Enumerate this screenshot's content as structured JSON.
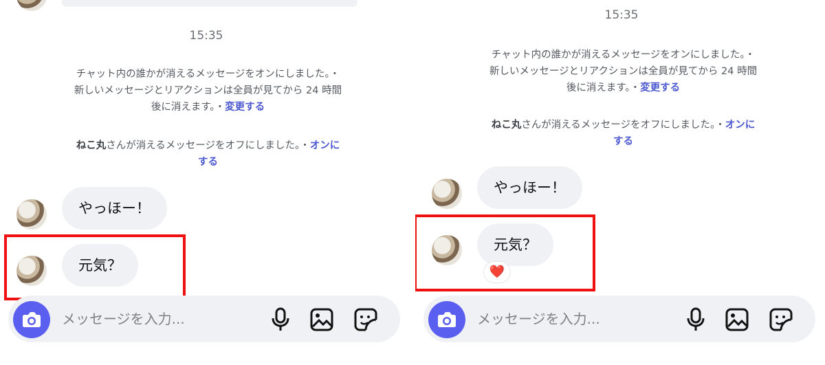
{
  "left": {
    "time": "15:35",
    "system_message_1": {
      "line1": "チャット内の誰かが消えるメッセージをオンにしました。・",
      "line2": "新しいメッセージとリアクションは全員が見てから 24 時間",
      "line3": "後に消えます。・",
      "link": "変更する"
    },
    "system_message_2": {
      "name": "ねこ丸",
      "text": "さんが消えるメッセージをオフにしました。・",
      "link1": "オンに",
      "link2": "する"
    },
    "messages": [
      {
        "text": "やっほー！"
      },
      {
        "text": "元気？"
      }
    ]
  },
  "right": {
    "time": "15:35",
    "system_message_1": {
      "line1": "チャット内の誰かが消えるメッセージをオンにしました。・",
      "line2": "新しいメッセージとリアクションは全員が見てから 24 時間",
      "line3": "後に消えます。・",
      "link": "変更する"
    },
    "system_message_2": {
      "name": "ねこ丸",
      "text": "さんが消えるメッセージをオフにしました。・",
      "link1": "オンに",
      "link2": "する"
    },
    "messages": [
      {
        "text": "やっほー！"
      },
      {
        "text": "元気？",
        "reaction": "❤️"
      }
    ]
  },
  "composer": {
    "placeholder": "メッセージを入力...",
    "icons": [
      "camera-icon",
      "microphone-icon",
      "image-icon",
      "sticker-icon"
    ]
  },
  "colors": {
    "accent": "#5b5ff0",
    "link": "#4a57cf",
    "highlight": "#ef1111",
    "bubble": "#f0f1f5"
  }
}
